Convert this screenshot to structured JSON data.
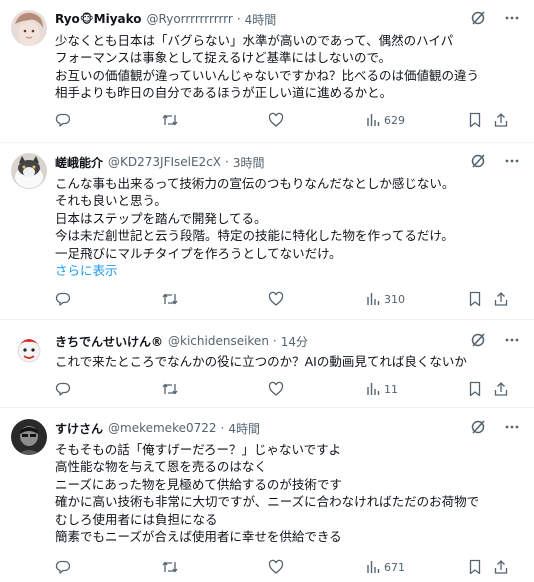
{
  "posts": [
    {
      "avatar": "avatar",
      "name": "Ryo🐵Miyako",
      "handle": "@Ryorrrrrrrrrrr",
      "time": "4時間",
      "lines": [
        "少なくとも日本は「バグらない」水準が高いのであって、偶然のハイパ",
        "フォーマンスは事象として捉えるけど基準にはしないので。",
        "お互いの価値観が違っていいんじゃないですかね？比べるのは価値観の違う",
        "相手よりも昨日の自分であるほうが正しい道に進めるかと。"
      ],
      "show_more": "",
      "views": "629"
    },
    {
      "avatar": "avatar",
      "name": "嵯峨能介",
      "handle": "@KD273JFIselE2cX",
      "time": "3時間",
      "lines": [
        "こんな事も出来るって技術力の宣伝のつもりなんだなとしか感じない。",
        "それも良いと思う。",
        "日本はステップを踏んで開発してる。",
        "今は未だ創世記と云う段階。特定の技能に特化した物を作ってるだけ。",
        "一足飛びにマルチタイプを作ろうとしてないだけ。"
      ],
      "show_more": "さらに表示",
      "views": "310"
    },
    {
      "avatar": "avatar",
      "name": "きちでんせいけん®",
      "handle": "@kichidenseiken",
      "time": "14分",
      "lines": [
        "これで来たところでなんかの役に立つのか？AIの動画見てれば良くないか"
      ],
      "show_more": "",
      "views": "11"
    },
    {
      "avatar": "avatar",
      "name": "すけさん",
      "handle": "@mekemeke0722",
      "time": "4時間",
      "lines": [
        "そもそもの話「俺すげーだろー？」じゃないですよ",
        "高性能な物を与えて恩を売るのはなく",
        "ニーズにあった物を見極めて供給するのが技術です",
        "確かに高い技術も非常に大切ですが、ニーズに合わなければただのお荷物で",
        "むしろ使用者には負担になる",
        "簡素でもニーズが合えば使用者に幸せを供給できる"
      ],
      "show_more": "",
      "views": "671"
    }
  ],
  "icons": {
    "grok": "grok-icon",
    "more": "more-icon",
    "reply": "reply-icon",
    "repost": "repost-icon",
    "like": "like-icon",
    "views": "views-icon",
    "bookmark": "bookmark-icon",
    "share": "share-icon"
  },
  "colors": {
    "text": "#0f1419",
    "secondary": "#536471",
    "link": "#1d9bf0",
    "divider": "#eff3f4"
  }
}
